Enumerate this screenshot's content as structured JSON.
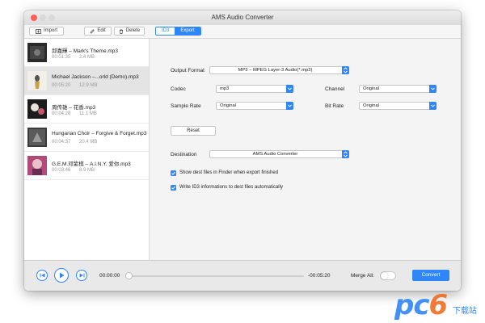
{
  "window": {
    "title": "AMS Audio Converter"
  },
  "toolbar": {
    "import": "Import",
    "edit": "Edit",
    "delete": "Delete",
    "tab_id3": "ID3",
    "tab_export": "Export"
  },
  "tracks": [
    {
      "name": "邱嘉輝 – Mark's Theme.mp3",
      "duration": "00:01:35",
      "size": "2.4 MB"
    },
    {
      "name": "Michael Jackson –...orld (Demo).mp3",
      "duration": "00:05:20",
      "size": "12.9 MB"
    },
    {
      "name": "周传雄 – 花香.mp3",
      "duration": "00:04:28",
      "size": "11.1 MB"
    },
    {
      "name": "Hungarian Choir – Forgive & Forget.mp3",
      "duration": "00:04:37",
      "size": "20.4 MB"
    },
    {
      "name": "G.E.M.邓紫棋 – A.I.N.Y. 爱你.mp3",
      "duration": "00:03:46",
      "size": "8.9 MB"
    }
  ],
  "export": {
    "output_format_label": "Output Format",
    "output_format_value": "MP3 – MPEG Layer-3 Audio(*.mp3)",
    "codec_label": "Codec",
    "codec_value": "mp3",
    "channel_label": "Channel",
    "channel_value": "Original",
    "sample_rate_label": "Sample Rate",
    "sample_rate_value": "Original",
    "bit_rate_label": "Bit Rate",
    "bit_rate_value": "Original",
    "reset": "Reset",
    "destination_label": "Destination",
    "destination_value": "AMS Audio Converter",
    "show_in_finder": "Show dest files in Finder when export finished",
    "write_id3": "Write ID3 informations to dest files automatically"
  },
  "player": {
    "time_current": "00:00:00",
    "time_remaining": "-00:05:20",
    "merge_all": "Merge All:",
    "convert": "Convert",
    "progress": 0
  },
  "watermark": {
    "brand": "pc6",
    "cn": "下载站"
  },
  "colors": {
    "accent": "#2f86f6",
    "close": "#fc605c"
  }
}
